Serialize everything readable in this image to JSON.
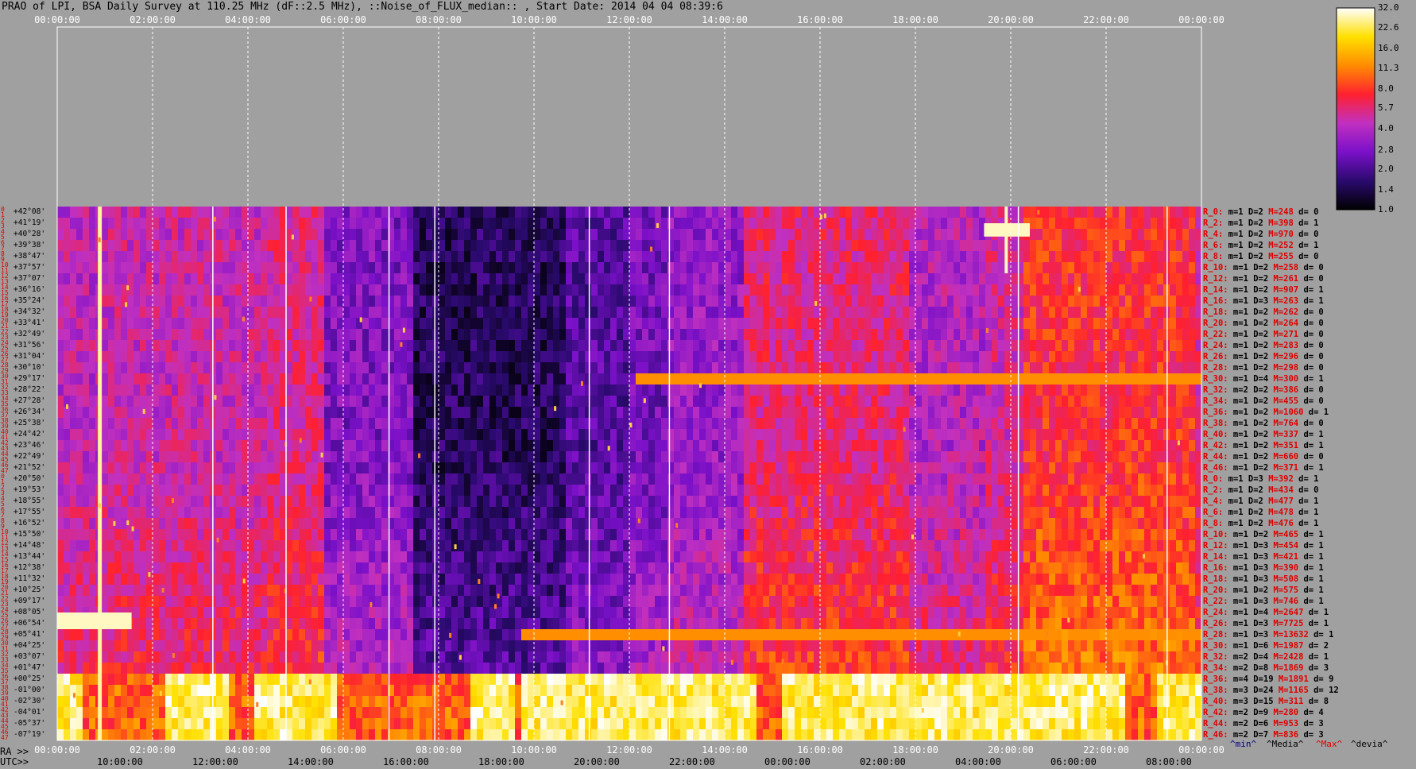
{
  "title": "PRAO of LPI, BSA Daily Survey at 110.25 MHz (dF::2.5 MHz), ::Noise_of_FLUX_median:: , Start Date: 2014 04 04 08:39:6",
  "chart_data": {
    "type": "heatmap",
    "title": "PRAO of LPI, BSA Daily Survey at 110.25 MHz (dF::2.5 MHz), ::Noise_of_FLUX_median:: , Start Date: 2014 04 04 08:39:6",
    "x_ticks_top": [
      "00:00:00",
      "02:00:00",
      "04:00:00",
      "06:00:00",
      "08:00:00",
      "10:00:00",
      "12:00:00",
      "14:00:00",
      "16:00:00",
      "18:00:00",
      "20:00:00",
      "22:00:00",
      "00:00:00"
    ],
    "x_ticks_ra": [
      "00:00:00",
      "02:00:00",
      "04:00:00",
      "06:00:00",
      "08:00:00",
      "10:00:00",
      "12:00:00",
      "14:00:00",
      "16:00:00",
      "18:00:00",
      "20:00:00",
      "22:00:00",
      "00:00:00"
    ],
    "ra_axis_label": "RA >>",
    "utc_axis_label": "UTC>>",
    "x_ticks_utc": [
      "10:00:00",
      "12:00:00",
      "14:00:00",
      "16:00:00",
      "18:00:00",
      "20:00:00",
      "22:00:00",
      "00:00:00",
      "02:00:00",
      "04:00:00",
      "06:00:00",
      "08:00:00"
    ],
    "row_indices": [
      "0",
      "1",
      "2",
      "3",
      "4",
      "5",
      "6",
      "7",
      "8",
      "9",
      "10",
      "11",
      "12",
      "13",
      "14",
      "15",
      "16",
      "17",
      "18",
      "19",
      "20",
      "21",
      "22",
      "23",
      "24",
      "25",
      "26",
      "27",
      "28",
      "29",
      "30",
      "31",
      "32",
      "33",
      "34",
      "35",
      "36",
      "37",
      "38",
      "39",
      "40",
      "41",
      "42",
      "43",
      "44",
      "45",
      "46",
      "47",
      "0",
      "1",
      "2",
      "3",
      "4",
      "5",
      "6",
      "7",
      "8",
      "9",
      "10",
      "11",
      "12",
      "13",
      "14",
      "15",
      "16",
      "17",
      "18",
      "19",
      "20",
      "21",
      "22",
      "23",
      "24",
      "25",
      "26",
      "27",
      "28",
      "29",
      "30",
      "31",
      "32",
      "33",
      "34",
      "35",
      "36",
      "37",
      "38",
      "39",
      "40",
      "41",
      "42",
      "43",
      "44",
      "45",
      "46",
      "47"
    ],
    "declinations": [
      "+42°08'",
      "+41°19'",
      "+40°28'",
      "+39°38'",
      "+38°47'",
      "+37°57'",
      "+37°07'",
      "+36°16'",
      "+35°24'",
      "+34°32'",
      "+33°41'",
      "+32°49'",
      "+31°56'",
      "+31°04'",
      "+30°10'",
      "+29°17'",
      "+28°22'",
      "+27°28'",
      "+26°34'",
      "+25°38'",
      "+24°42'",
      "+23°46'",
      "+22°49'",
      "+21°52'",
      "+20°50'",
      "+19°53'",
      "+18°55'",
      "+17°55'",
      "+16°52'",
      "+15°50'",
      "+14°48'",
      "+13°44'",
      "+12°38'",
      "+11°32'",
      "+10°25'",
      "+09°17'",
      "+08°05'",
      "+06°54'",
      "+05°41'",
      "+04°25'",
      "+03°07'",
      "+01°47'",
      "+00°25'",
      "-01°00'",
      "-02°30'",
      "-04°01'",
      "-05°37'",
      "-07°19'"
    ],
    "beam_stats": [
      {
        "r": "R_0:",
        "m": "m=1",
        "D": "D=2",
        "M": "M=248",
        "d": "d= 0"
      },
      {
        "r": "R_2:",
        "m": "m=1",
        "D": "D=2",
        "M": "M=398",
        "d": "d= 1"
      },
      {
        "r": "R_4:",
        "m": "m=1",
        "D": "D=2",
        "M": "M=970",
        "d": "d= 0"
      },
      {
        "r": "R_6:",
        "m": "m=1",
        "D": "D=2",
        "M": "M=252",
        "d": "d= 1"
      },
      {
        "r": "R_8:",
        "m": "m=1",
        "D": "D=2",
        "M": "M=255",
        "d": "d= 0"
      },
      {
        "r": "R_10:",
        "m": "m=1",
        "D": "D=2",
        "M": "M=258",
        "d": "d= 0"
      },
      {
        "r": "R_12:",
        "m": "m=1",
        "D": "D=2",
        "M": "M=261",
        "d": "d= 0"
      },
      {
        "r": "R_14:",
        "m": "m=1",
        "D": "D=2",
        "M": "M=907",
        "d": "d= 1"
      },
      {
        "r": "R_16:",
        "m": "m=1",
        "D": "D=3",
        "M": "M=263",
        "d": "d= 1"
      },
      {
        "r": "R_18:",
        "m": "m=1",
        "D": "D=2",
        "M": "M=262",
        "d": "d= 0"
      },
      {
        "r": "R_20:",
        "m": "m=1",
        "D": "D=2",
        "M": "M=264",
        "d": "d= 0"
      },
      {
        "r": "R_22:",
        "m": "m=1",
        "D": "D=2",
        "M": "M=271",
        "d": "d= 0"
      },
      {
        "r": "R_24:",
        "m": "m=1",
        "D": "D=2",
        "M": "M=283",
        "d": "d= 0"
      },
      {
        "r": "R_26:",
        "m": "m=1",
        "D": "D=2",
        "M": "M=296",
        "d": "d= 0"
      },
      {
        "r": "R_28:",
        "m": "m=1",
        "D": "D=2",
        "M": "M=298",
        "d": "d= 0"
      },
      {
        "r": "R_30:",
        "m": "m=1",
        "D": "D=4",
        "M": "M=300",
        "d": "d= 1"
      },
      {
        "r": "R_32:",
        "m": "m=2",
        "D": "D=2",
        "M": "M=386",
        "d": "d= 0"
      },
      {
        "r": "R_34:",
        "m": "m=1",
        "D": "D=2",
        "M": "M=455",
        "d": "d= 0"
      },
      {
        "r": "R_36:",
        "m": "m=1",
        "D": "D=2",
        "M": "M=1060",
        "d": "d= 1"
      },
      {
        "r": "R_38:",
        "m": "m=1",
        "D": "D=2",
        "M": "M=764",
        "d": "d= 0"
      },
      {
        "r": "R_40:",
        "m": "m=1",
        "D": "D=2",
        "M": "M=337",
        "d": "d= 1"
      },
      {
        "r": "R_42:",
        "m": "m=1",
        "D": "D=2",
        "M": "M=351",
        "d": "d= 1"
      },
      {
        "r": "R_44:",
        "m": "m=1",
        "D": "D=2",
        "M": "M=660",
        "d": "d= 0"
      },
      {
        "r": "R_46:",
        "m": "m=1",
        "D": "D=2",
        "M": "M=371",
        "d": "d= 1"
      },
      {
        "r": "R_0:",
        "m": "m=1",
        "D": "D=3",
        "M": "M=392",
        "d": "d= 1"
      },
      {
        "r": "R_2:",
        "m": "m=1",
        "D": "D=2",
        "M": "M=434",
        "d": "d= 0"
      },
      {
        "r": "R_4:",
        "m": "m=1",
        "D": "D=2",
        "M": "M=477",
        "d": "d= 1"
      },
      {
        "r": "R_6:",
        "m": "m=1",
        "D": "D=2",
        "M": "M=478",
        "d": "d= 1"
      },
      {
        "r": "R_8:",
        "m": "m=1",
        "D": "D=2",
        "M": "M=476",
        "d": "d= 1"
      },
      {
        "r": "R_10:",
        "m": "m=1",
        "D": "D=2",
        "M": "M=465",
        "d": "d= 1"
      },
      {
        "r": "R_12:",
        "m": "m=1",
        "D": "D=3",
        "M": "M=454",
        "d": "d= 1"
      },
      {
        "r": "R_14:",
        "m": "m=1",
        "D": "D=3",
        "M": "M=421",
        "d": "d= 1"
      },
      {
        "r": "R_16:",
        "m": "m=1",
        "D": "D=3",
        "M": "M=390",
        "d": "d= 1"
      },
      {
        "r": "R_18:",
        "m": "m=1",
        "D": "D=3",
        "M": "M=508",
        "d": "d= 1"
      },
      {
        "r": "R_20:",
        "m": "m=1",
        "D": "D=2",
        "M": "M=575",
        "d": "d= 1"
      },
      {
        "r": "R_22:",
        "m": "m=1",
        "D": "D=3",
        "M": "M=746",
        "d": "d= 1"
      },
      {
        "r": "R_24:",
        "m": "m=1",
        "D": "D=4",
        "M": "M=2647",
        "d": "d= 1"
      },
      {
        "r": "R_26:",
        "m": "m=1",
        "D": "D=3",
        "M": "M=7725",
        "d": "d= 1"
      },
      {
        "r": "R_28:",
        "m": "m=1",
        "D": "D=3",
        "M": "M=13632",
        "d": "d= 1"
      },
      {
        "r": "R_30:",
        "m": "m=1",
        "D": "D=6",
        "M": "M=1987",
        "d": "d= 2"
      },
      {
        "r": "R_32:",
        "m": "m=2",
        "D": "D=4",
        "M": "M=2428",
        "d": "d= 1"
      },
      {
        "r": "R_34:",
        "m": "m=2",
        "D": "D=8",
        "M": "M=1869",
        "d": "d= 3"
      },
      {
        "r": "R_36:",
        "m": "m=4",
        "D": "D=19",
        "M": "M=1891",
        "d": "d= 9"
      },
      {
        "r": "R_38:",
        "m": "m=3",
        "D": "D=24",
        "M": "M=1165",
        "d": "d= 12"
      },
      {
        "r": "R_40:",
        "m": "m=3",
        "D": "D=15",
        "M": "M=311",
        "d": "d= 8"
      },
      {
        "r": "R_42:",
        "m": "m=2",
        "D": "D=9",
        "M": "M=280",
        "d": "d= 4"
      },
      {
        "r": "R_44:",
        "m": "m=2",
        "D": "D=6",
        "M": "M=953",
        "d": "d= 3"
      },
      {
        "r": "R_46:",
        "m": "m=2",
        "D": "D=7",
        "M": "M=836",
        "d": "d= 3"
      }
    ],
    "stat_legend": [
      "^min^",
      "^Media^",
      "^Max^",
      "^devia^"
    ],
    "colorbar_ticks": [
      "32.0",
      "22.6",
      "16.0",
      "11.3",
      "8.0",
      "5.7",
      "4.0",
      "2.8",
      "2.0",
      "1.4",
      "1.0"
    ],
    "colorbar_range": [
      1.0,
      32.0
    ],
    "colorbar_scale": "log2",
    "colormap": [
      "#000000",
      "#2a0a6e",
      "#7a10c8",
      "#c030c0",
      "#ff2030",
      "#ff8c00",
      "#ffe000",
      "#ffffff"
    ]
  },
  "colors": {
    "background": "#a0a0a0",
    "beam_label": "#e00000",
    "stat_key": "#000000",
    "max_value": "#e00000",
    "min_legend": "#000080",
    "median_legend": "#000000",
    "max_legend": "#e00000",
    "devia_legend": "#000000"
  }
}
